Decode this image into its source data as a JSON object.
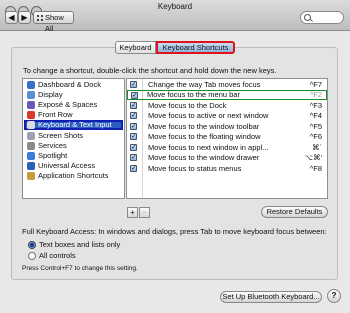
{
  "window": {
    "title": "Keyboard"
  },
  "toolbar": {
    "show_all": "Show All",
    "back": "◀",
    "forward": "▶"
  },
  "tabs": [
    {
      "label": "Keyboard"
    },
    {
      "label": "Keyboard Shortcuts"
    }
  ],
  "hint": "To change a shortcut, double-click the shortcut and hold down the new keys.",
  "categories": [
    {
      "label": "Dashboard & Dock",
      "icon": "dashboard-icon",
      "color": "#3a6fc9"
    },
    {
      "label": "Display",
      "icon": "display-icon",
      "color": "#5a8fd6"
    },
    {
      "label": "Exposé & Spaces",
      "icon": "expose-icon",
      "color": "#6a5ab8"
    },
    {
      "label": "Front Row",
      "icon": "front-row-icon",
      "color": "#d8392b"
    },
    {
      "label": "Keyboard & Text Input",
      "icon": "keyboard-icon",
      "color": "#dddddd",
      "selected": true
    },
    {
      "label": "Screen Shots",
      "icon": "screenshot-icon",
      "color": "#9aa4b0"
    },
    {
      "label": "Services",
      "icon": "services-icon",
      "color": "#8a8a8a"
    },
    {
      "label": "Spotlight",
      "icon": "spotlight-icon",
      "color": "#3a7bd5"
    },
    {
      "label": "Universal Access",
      "icon": "universal-access-icon",
      "color": "#2a5fb5"
    },
    {
      "label": "Application Shortcuts",
      "icon": "app-shortcuts-icon",
      "color": "#c89a3a"
    }
  ],
  "shortcuts": [
    {
      "label": "Change the way Tab moves focus",
      "key": "^F7",
      "checked": true
    },
    {
      "label": "Move focus to the menu bar",
      "key": "^F2",
      "checked": true,
      "highlight": true
    },
    {
      "label": "Move focus to the Dock",
      "key": "^F3",
      "checked": true
    },
    {
      "label": "Move focus to active or next window",
      "key": "^F4",
      "checked": true
    },
    {
      "label": "Move focus to the window toolbar",
      "key": "^F5",
      "checked": true
    },
    {
      "label": "Move focus to the floating window",
      "key": "^F6",
      "checked": true
    },
    {
      "label": "Move focus to next window in appl...",
      "key": "⌘`",
      "checked": true
    },
    {
      "label": "Move focus to the window drawer",
      "key": "⌥⌘'",
      "checked": true
    },
    {
      "label": "Move focus to status menus",
      "key": "^F8",
      "checked": true
    }
  ],
  "buttons": {
    "plus": "+",
    "minus": "−",
    "restore": "Restore Defaults",
    "bluetooth": "Set Up Bluetooth Keyboard...",
    "help": "?"
  },
  "full_access": {
    "text": "Full Keyboard Access: In windows and dialogs, press Tab to move keyboard focus between:",
    "options": [
      {
        "label": "Text boxes and lists only",
        "selected": true
      },
      {
        "label": "All controls",
        "selected": false
      }
    ],
    "note": "Press Control+F7 to change this setting."
  }
}
